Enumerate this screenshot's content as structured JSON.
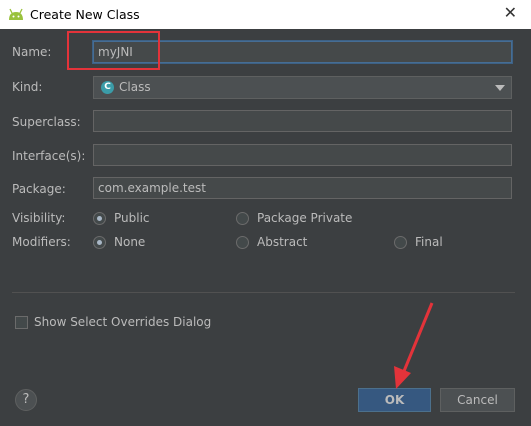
{
  "window": {
    "title": "Create New Class"
  },
  "form": {
    "name_label": "Name:",
    "name_value": "myJNI",
    "kind_label": "Kind:",
    "kind_value": "Class",
    "kind_icon_letter": "C",
    "superclass_label": "Superclass:",
    "superclass_value": "",
    "interfaces_label": "Interface(s):",
    "interfaces_value": "",
    "package_label": "Package:",
    "package_value": "com.example.test",
    "visibility_label": "Visibility:",
    "visibility_options": [
      "Public",
      "Package Private"
    ],
    "visibility_selected": "Public",
    "modifiers_label": "Modifiers:",
    "modifiers_options": [
      "None",
      "Abstract",
      "Final"
    ],
    "modifiers_selected": "None",
    "show_overrides_label": "Show Select Overrides Dialog",
    "show_overrides_checked": false
  },
  "buttons": {
    "help": "?",
    "ok": "OK",
    "cancel": "Cancel"
  },
  "colors": {
    "background": "#3c3f41",
    "ok_button": "#365880",
    "annotation": "#e3333a",
    "android_green": "#9ac23c"
  }
}
